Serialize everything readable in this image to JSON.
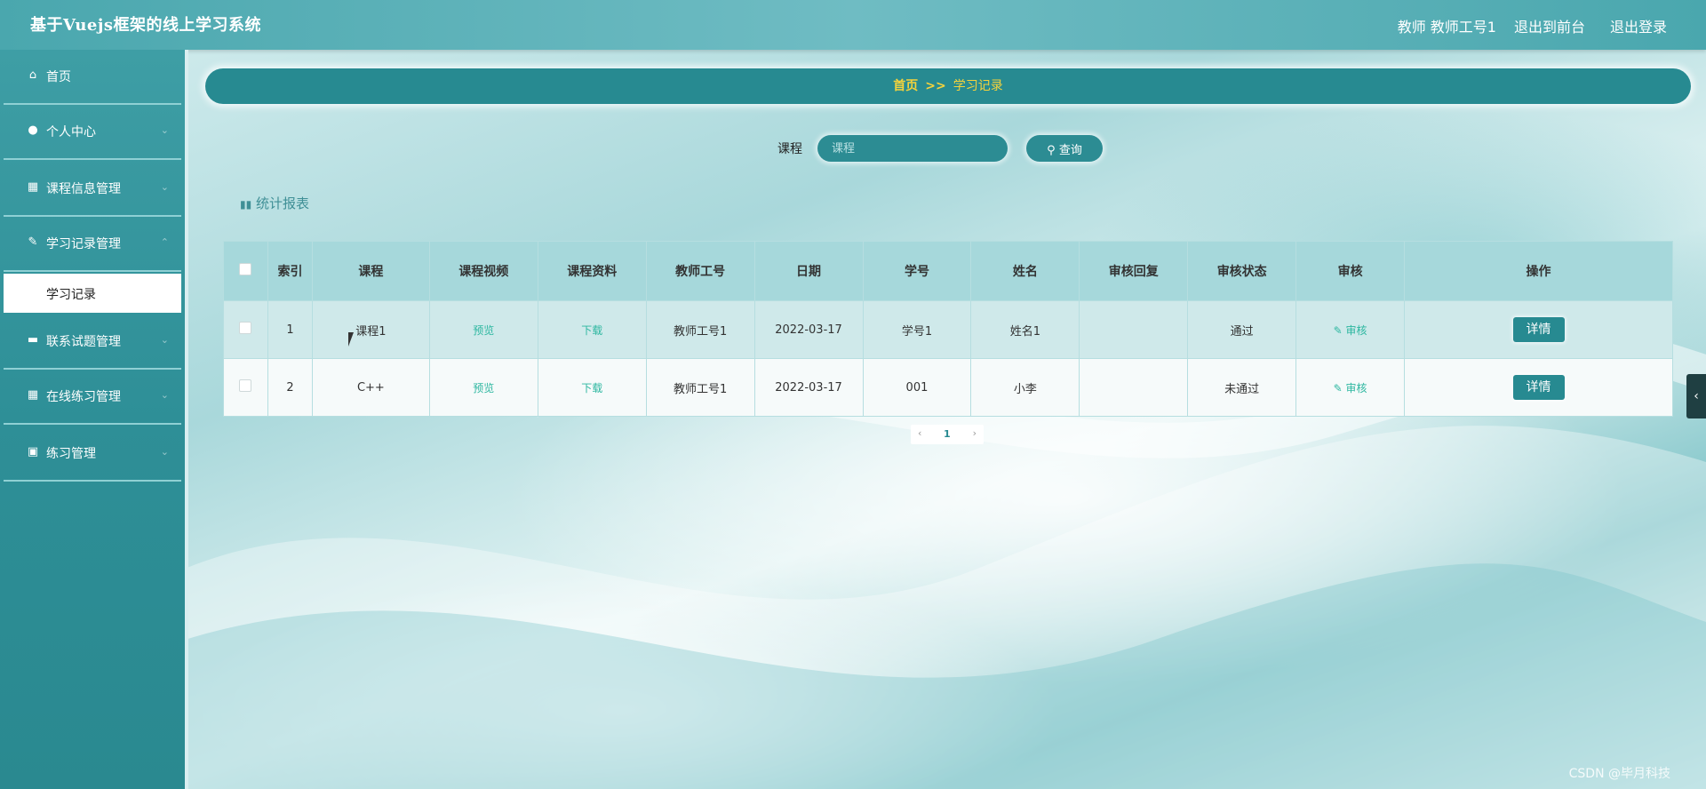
{
  "header": {
    "title": "基于Vuejs框架的线上学习系统",
    "user": "教师 教师工号1",
    "front_link": "退出到前台",
    "logout_link": "退出登录"
  },
  "sidebar": {
    "items": [
      {
        "label": "首页",
        "icon": "home-icon"
      },
      {
        "label": "个人中心",
        "icon": "user-icon"
      },
      {
        "label": "课程信息管理",
        "icon": "grid-icon"
      },
      {
        "label": "学习记录管理",
        "icon": "edit-icon"
      },
      {
        "label": "联系试题管理",
        "icon": "monitor-icon"
      },
      {
        "label": "在线练习管理",
        "icon": "grid-icon"
      },
      {
        "label": "练习管理",
        "icon": "clipboard-icon"
      }
    ],
    "active_sub": "学习记录"
  },
  "breadcrumb": {
    "home": "首页",
    "separator": ">>",
    "current": "学习记录"
  },
  "search": {
    "label": "课程",
    "placeholder": "课程",
    "button": "查询"
  },
  "report_button": "统计报表",
  "table": {
    "headers": [
      "索引",
      "课程",
      "课程视频",
      "课程资料",
      "教师工号",
      "日期",
      "学号",
      "姓名",
      "审核回复",
      "审核状态",
      "审核",
      "操作"
    ],
    "rows": [
      {
        "index": "1",
        "course": "课程1",
        "video": "预览",
        "material": "下载",
        "teacher": "教师工号1",
        "date": "2022-03-17",
        "student_no": "学号1",
        "name": "姓名1",
        "reply": "",
        "status": "通过",
        "audit": "审核",
        "action": "详情"
      },
      {
        "index": "2",
        "course": "C++",
        "video": "预览",
        "material": "下载",
        "teacher": "教师工号1",
        "date": "2022-03-17",
        "student_no": "001",
        "name": "小李",
        "reply": "",
        "status": "未通过",
        "audit": "审核",
        "action": "详情"
      }
    ]
  },
  "pagination": {
    "prev": "‹",
    "current": "1",
    "next": "›"
  },
  "side_tab": "‹",
  "watermark": "CSDN @毕月科技"
}
